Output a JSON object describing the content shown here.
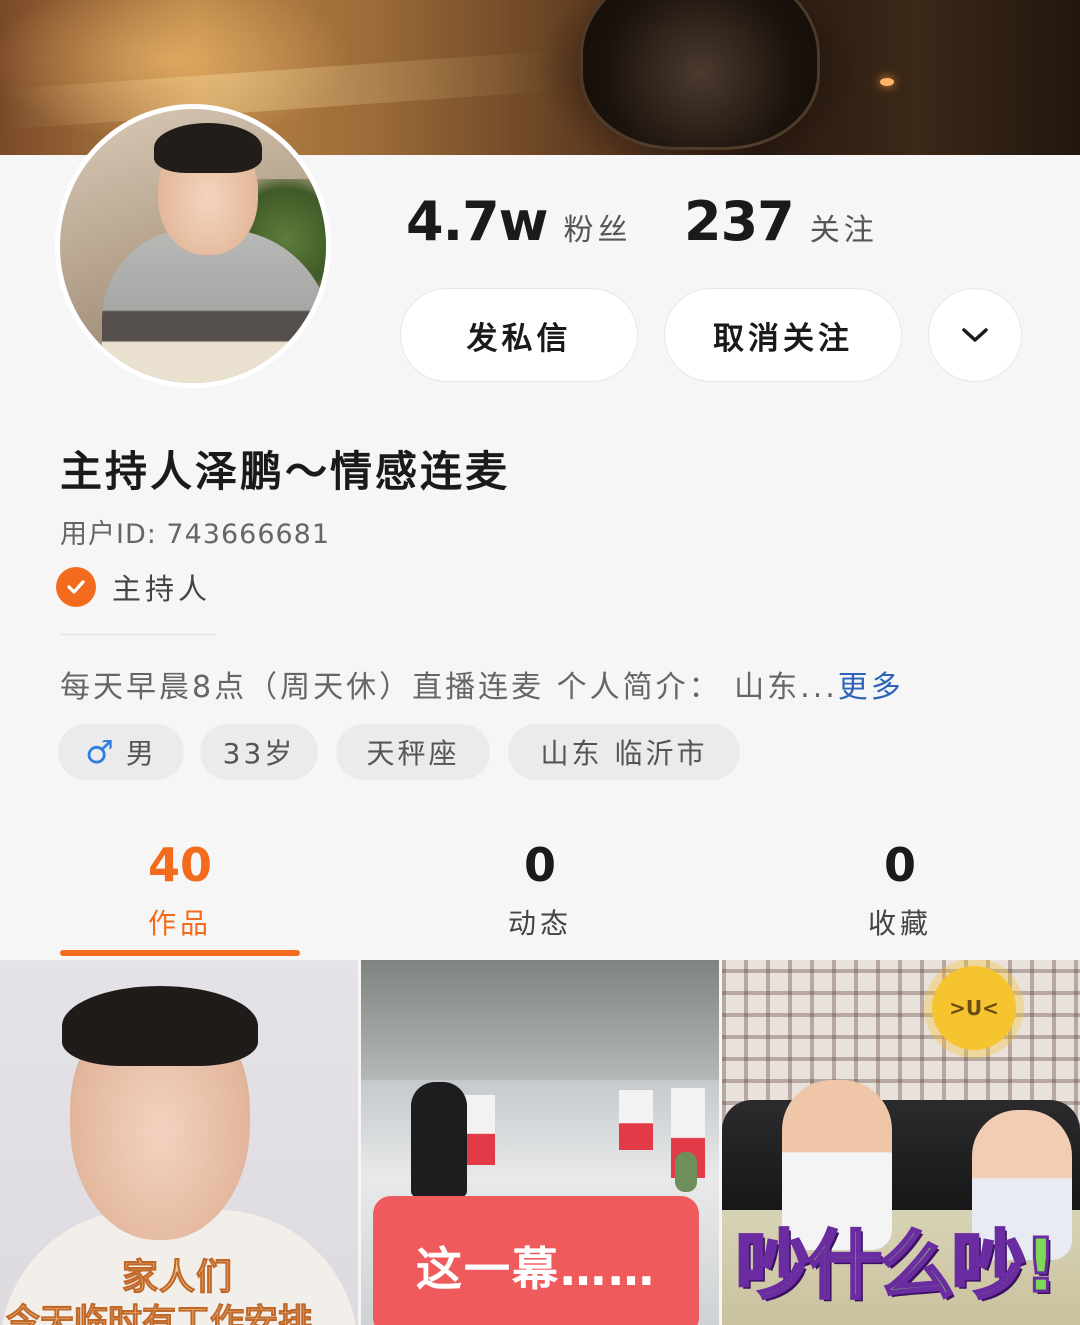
{
  "profile": {
    "name": "主持人泽鹏～情感连麦",
    "user_id": "用户ID: 743666681",
    "verified_label": "主持人",
    "bio": "每天早晨8点（周天休）直播连麦 个人简介： 山东",
    "bio_ellipsis": "...",
    "bio_more": "更多"
  },
  "stats": {
    "fans_count": "4.7w",
    "fans_label": "粉丝",
    "following_count": "237",
    "following_label": "关注"
  },
  "actions": {
    "message_label": "发私信",
    "unfollow_label": "取消关注",
    "more_icon": "chevron-down-icon"
  },
  "tags": {
    "gender_symbol": "♂",
    "gender": "男",
    "age": "33岁",
    "zodiac": "天秤座",
    "location": "山东 临沂市"
  },
  "tabs": [
    {
      "count": "40",
      "label": "作品",
      "active": true
    },
    {
      "count": "0",
      "label": "动态",
      "active": false
    },
    {
      "count": "0",
      "label": "收藏",
      "active": false
    }
  ],
  "grid": {
    "items": [
      {
        "caption_line1": "家人们",
        "caption_line2": "今天临时有工作安排"
      },
      {
        "caption": "这一幕……"
      },
      {
        "caption": "吵什么吵!",
        "sticker": ">U<"
      }
    ]
  },
  "colors": {
    "accent": "#f36b1c",
    "link": "#2f63b8",
    "gender": "#2f7fe0"
  }
}
